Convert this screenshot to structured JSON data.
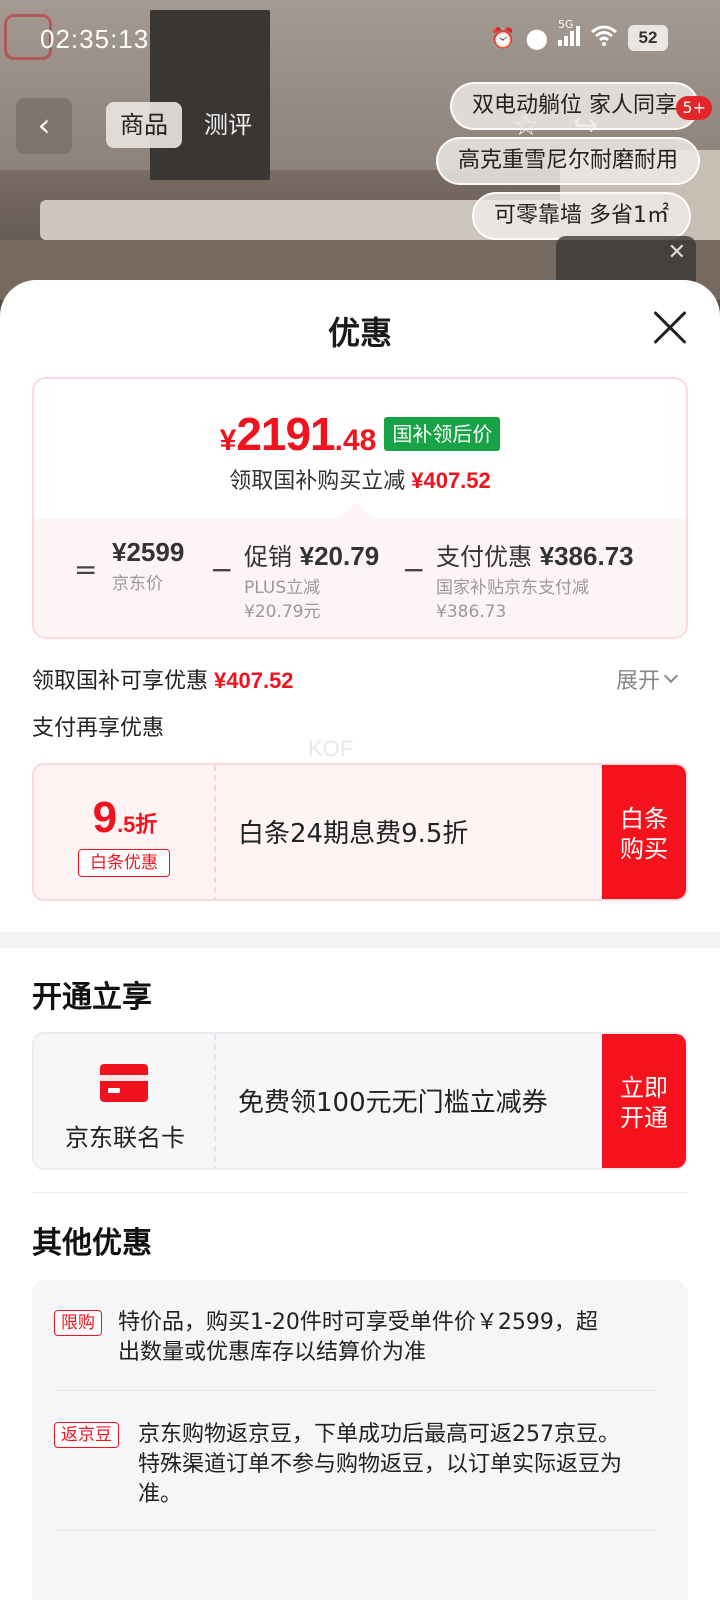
{
  "status_bar": {
    "time": "02:35:13",
    "network": "5G",
    "battery": "52"
  },
  "product_header": {
    "tabs": [
      "商品",
      "测评"
    ],
    "feature_chips": [
      "双电动躺位 家人同享",
      "高克重雪尼尔耐磨耐用",
      "可零靠墙 多省1㎡"
    ],
    "badge": "5+"
  },
  "sheet": {
    "title": "优惠",
    "price_card": {
      "currency": "¥",
      "price_int": "2191",
      "price_dec": ".48",
      "price_tag": "国补领后价",
      "sub_text": "领取国补购买立减",
      "sub_amount": "¥407.52",
      "breakdown": [
        {
          "op": "=",
          "label": "",
          "amount": "¥2599",
          "notes": [
            "京东价"
          ]
        },
        {
          "op": "−",
          "label": "促销",
          "amount": "¥20.79",
          "notes": [
            "PLUS立减",
            "¥20.79元"
          ]
        },
        {
          "op": "−",
          "label": "支付优惠",
          "amount": "¥386.73",
          "notes": [
            "国家补贴京东支付减",
            "¥386.73"
          ]
        }
      ]
    },
    "subsidy_row": {
      "label": "领取国补可享优惠",
      "amount": "¥407.52",
      "expand": "展开"
    },
    "pay_section_title": "支付再享优惠",
    "watermark": "KOF",
    "baitiao_coupon": {
      "discount_num": "9",
      "discount_unit": ".5折",
      "tag": "白条优惠",
      "desc": "白条24期息费9.5折",
      "button": "白条购买"
    },
    "open_section_title": "开通立享",
    "card_coupon": {
      "card_label": "京东联名卡",
      "desc": "免费领100元无门槛立减券",
      "button": "立即开通"
    },
    "other_section_title": "其他优惠",
    "other_items": [
      {
        "tag": "限购",
        "text": "特价品，购买1-20件时可享受单件价￥2599，超出数量或优惠库存以结算价为准"
      },
      {
        "tag": "返京豆",
        "text": "京东购物返京豆，下单成功后最高可返257京豆。特殊渠道订单不参与购物返豆，以订单实际返豆为准。"
      }
    ]
  },
  "colors": {
    "accent_red": "#f0131d",
    "tag_green": "#19a347",
    "button_red": "#f5121c"
  }
}
